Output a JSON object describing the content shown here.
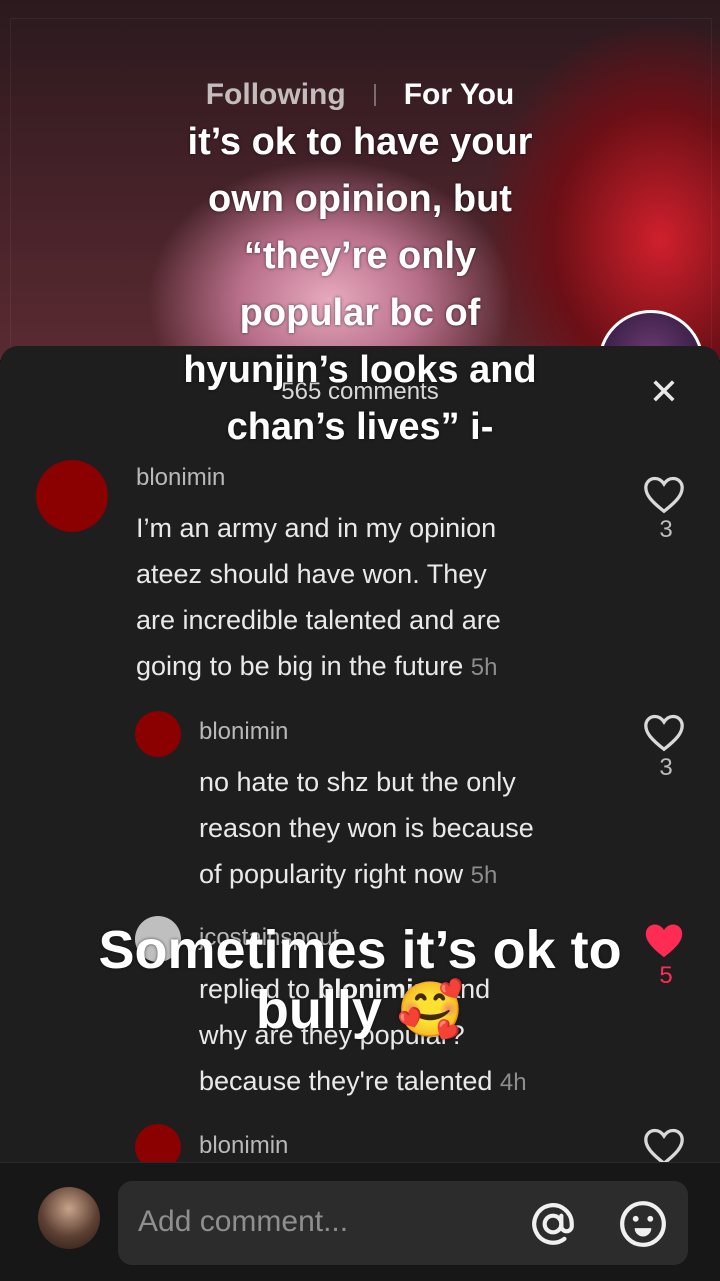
{
  "nav": {
    "following": "Following",
    "for_you": "For You"
  },
  "video": {
    "caption_top_lines": [
      "it’s ok to have your",
      "own opinion, but",
      "“they’re only",
      "popular bc of",
      "hyunjin’s looks and",
      "chan’s lives” i-"
    ],
    "caption_bottom_lines": [
      "Sometimes it’s ok to",
      "bully 🥰"
    ]
  },
  "panel": {
    "header": "565 comments",
    "close_icon": "close-icon"
  },
  "comments": [
    {
      "user": "blonimin",
      "lines": [
        "I’m an army and in my opinion",
        "ateez should have won. They",
        "are incredible talented and are",
        "going to be big in the future"
      ],
      "time": "5h",
      "likes": "3",
      "liked": false
    },
    {
      "user": "blonimin",
      "lines": [
        "no hate to shz but the only",
        "reason they won is because",
        "of popularity right now"
      ],
      "time": "5h",
      "likes": "3",
      "liked": false
    },
    {
      "user": "jcostainspout",
      "reply_prefix": "replied to ",
      "reply_to": "blonimin",
      "reply_suffix": ": and",
      "lines": [
        "why are they popular?",
        "because they're talented"
      ],
      "time": "4h",
      "likes": "5",
      "liked": true
    },
    {
      "user": "blonimin",
      "likes": "",
      "liked": false
    }
  ],
  "bottom": {
    "placeholder": "Add comment...",
    "at_icon": "at-icon",
    "emoji_icon": "emoji-icon"
  },
  "colors": {
    "panel_bg": "#1e1e1e",
    "liked_heart": "#fe2c55",
    "avatar_red": "#8b0000"
  }
}
